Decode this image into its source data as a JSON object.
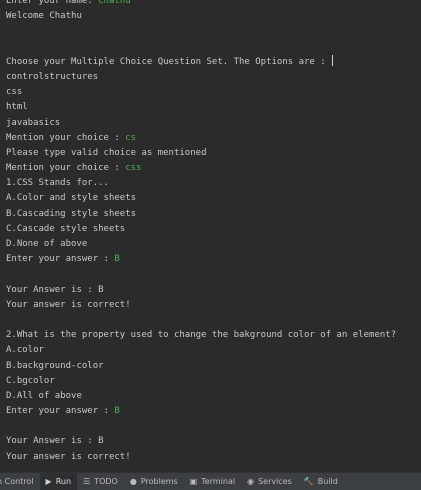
{
  "console": {
    "lines": [
      {
        "t": "Enter your name: ",
        "in": "Chathu",
        "clip": true
      },
      {
        "t": "Welcome Chathu"
      },
      {
        "t": ""
      },
      {
        "t": ""
      },
      {
        "t": "Choose your Multiple Choice Question Set. The Options are : ",
        "cursor": true
      },
      {
        "t": "controlstructures"
      },
      {
        "t": "css"
      },
      {
        "t": "html"
      },
      {
        "t": "javabasics"
      },
      {
        "t": "Mention your choice : ",
        "in": "cs"
      },
      {
        "t": "Please type valid choice as mentioned"
      },
      {
        "t": "Mention your choice : ",
        "in": "css"
      },
      {
        "t": "1.CSS Stands for..."
      },
      {
        "t": "A.Color and style sheets"
      },
      {
        "t": "B.Cascading style sheets"
      },
      {
        "t": "C.Cascade style sheets"
      },
      {
        "t": "D.None of above"
      },
      {
        "t": "Enter your answer : ",
        "in": "B"
      },
      {
        "t": ""
      },
      {
        "t": "Your Answer is : B"
      },
      {
        "t": "Your answer is correct!"
      },
      {
        "t": ""
      },
      {
        "t": "2.What is the property used to change the bakground color of an element?"
      },
      {
        "t": "A.color"
      },
      {
        "t": "B.background-color"
      },
      {
        "t": "C.bgcolor"
      },
      {
        "t": "D.All of above"
      },
      {
        "t": "Enter your answer : ",
        "in": "B"
      },
      {
        "t": ""
      },
      {
        "t": "Your Answer is : B"
      },
      {
        "t": "Your answer is correct!"
      }
    ]
  },
  "toolbar": {
    "tabs": [
      {
        "label": "n Control",
        "icon": "",
        "name": "tab-version-control"
      },
      {
        "label": "Run",
        "icon": "▶",
        "name": "tab-run",
        "active": true
      },
      {
        "label": "TODO",
        "icon": "☰",
        "name": "tab-todo"
      },
      {
        "label": "Problems",
        "icon": "●",
        "name": "tab-problems"
      },
      {
        "label": "Terminal",
        "icon": "▣",
        "name": "tab-terminal"
      },
      {
        "label": "Services",
        "icon": "◉",
        "name": "tab-services"
      },
      {
        "label": "Build",
        "icon": "🔨",
        "name": "tab-build"
      }
    ]
  },
  "colors": {
    "console_bg": "#2b2b2b",
    "console_text": "#c8c8c8",
    "user_input": "#4eb04e",
    "toolbar_bg": "#3c3f41"
  }
}
